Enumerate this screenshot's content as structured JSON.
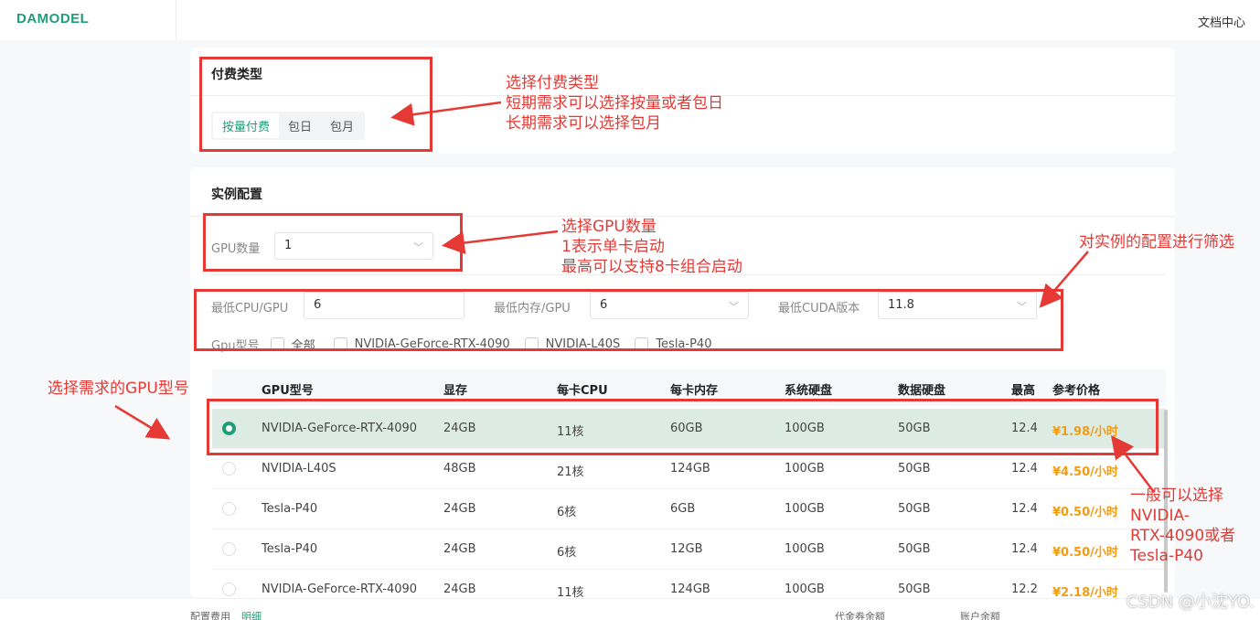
{
  "header": {
    "logo": "DAMODEL",
    "docs": "文档中心"
  },
  "billing": {
    "title": "付费类型",
    "options": [
      "按量付费",
      "包日",
      "包月"
    ]
  },
  "instance": {
    "title": "实例配置",
    "gpu_count_label": "GPU数量",
    "gpu_count_value": "1",
    "min_cpu_label": "最低CPU/GPU",
    "min_cpu_value": "6",
    "min_mem_label": "最低内存/GPU",
    "min_mem_value": "6",
    "min_cuda_label": "最低CUDA版本",
    "min_cuda_value": "11.8",
    "gpu_model_label": "Gpu型号",
    "gpu_models": [
      "全部",
      "NVIDIA-GeForce-RTX-4090",
      "NVIDIA-L40S",
      "Tesla-P40"
    ]
  },
  "table": {
    "headers": [
      "GPU型号",
      "显存",
      "每卡CPU",
      "每卡内存",
      "系统硬盘",
      "数据硬盘",
      "最高",
      "参考价格"
    ],
    "rows": [
      [
        "NVIDIA-GeForce-RTX-4090",
        "24GB",
        "11核",
        "60GB",
        "100GB",
        "50GB",
        "12.4",
        "¥1.98/小时"
      ],
      [
        "NVIDIA-L40S",
        "48GB",
        "21核",
        "124GB",
        "100GB",
        "50GB",
        "12.4",
        "¥4.50/小时"
      ],
      [
        "Tesla-P40",
        "24GB",
        "6核",
        "6GB",
        "100GB",
        "50GB",
        "12.4",
        "¥0.50/小时"
      ],
      [
        "Tesla-P40",
        "24GB",
        "6核",
        "12GB",
        "100GB",
        "50GB",
        "12.4",
        "¥0.50/小时"
      ],
      [
        "NVIDIA-GeForce-RTX-4090",
        "24GB",
        "11核",
        "124GB",
        "100GB",
        "50GB",
        "12.2",
        "¥2.18/小时"
      ]
    ]
  },
  "footer": {
    "cost": "配置费用",
    "detail": "明细",
    "voucher": "代金券余额",
    "balance": "账户余额"
  },
  "annotations": {
    "billing_note": [
      "选择付费类型",
      "短期需求可以选择按量或者包日",
      "长期需求可以选择包月"
    ],
    "gpu_count_note": [
      "选择GPU数量",
      "1表示单卡启动",
      "最高可以支持8卡组合启动"
    ],
    "filter_note": "对实例的配置进行筛选",
    "gpu_model_note": "选择需求的GPU型号",
    "recommend_note": [
      "一般可以选择",
      "NVIDIA-",
      "RTX-4090或者",
      "Tesla-P40"
    ]
  },
  "watermark": "CSDN @小沈YO."
}
